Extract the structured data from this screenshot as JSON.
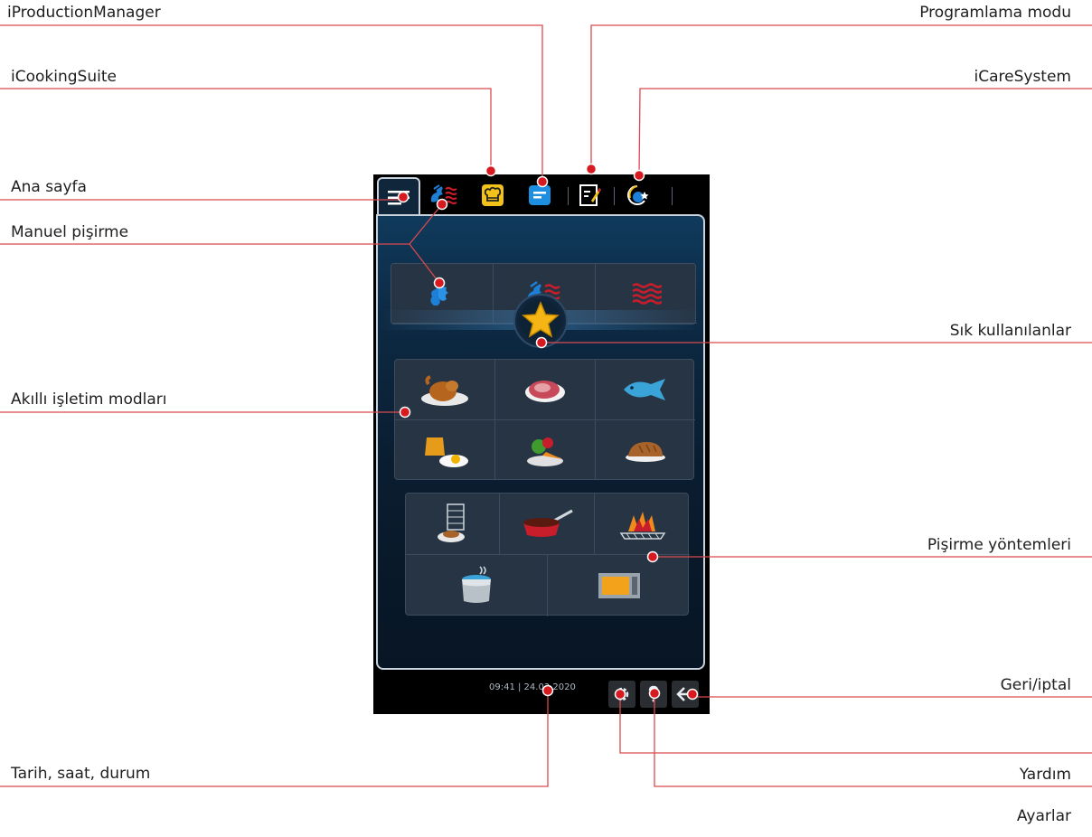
{
  "labels": {
    "iproduction_manager": "iProductionManager",
    "icooking_suite": "iCookingSuite",
    "ana_sayfa": "Ana sayfa",
    "manuel_pisirme": "Manuel pişirme",
    "akilli_isletim": "Akıllı işletim modları",
    "tarih_saat": "Tarih, saat, durum",
    "programlama_modu": "Programlama modu",
    "icare_system": "iCareSystem",
    "sik_kullanilanlar": "Sık kullanılanlar",
    "pisirme_yontemleri": "Pişirme yöntemleri",
    "geri_iptal": "Geri/iptal",
    "yardim": "Yardım",
    "ayarlar": "Ayarlar"
  },
  "device": {
    "clock": "09:41 | 24.03.2020",
    "tabs": [
      "home-menu-icon",
      "manual-cooking-icon",
      "icooking-suite-icon",
      "iproduction-manager-icon",
      "programming-mode-icon",
      "icare-system-icon"
    ],
    "manual_modes": [
      "steam-icon",
      "combi-steam-icon",
      "hot-air-icon"
    ],
    "intelligent_modes": [
      "poultry-icon",
      "meat-icon",
      "fish-icon",
      "egg-dishes-icon",
      "side-dishes-icon",
      "bakery-icon"
    ],
    "cooking_methods": [
      "finishing-icon",
      "pan-frying-icon",
      "grilling-icon",
      "boiling-pot-icon",
      "holding-cabinet-icon"
    ],
    "bottom_buttons": [
      "settings-icon",
      "help-icon",
      "back-icon"
    ]
  },
  "colors": {
    "callout_line": "#d94a4f",
    "callout_dot": "#d71920",
    "screen_bg": "#0d2a44",
    "tile": "#263444",
    "steam_blue": "#1e7fd6",
    "heat_red": "#c81d2a",
    "suite_yellow": "#f2c21b"
  }
}
